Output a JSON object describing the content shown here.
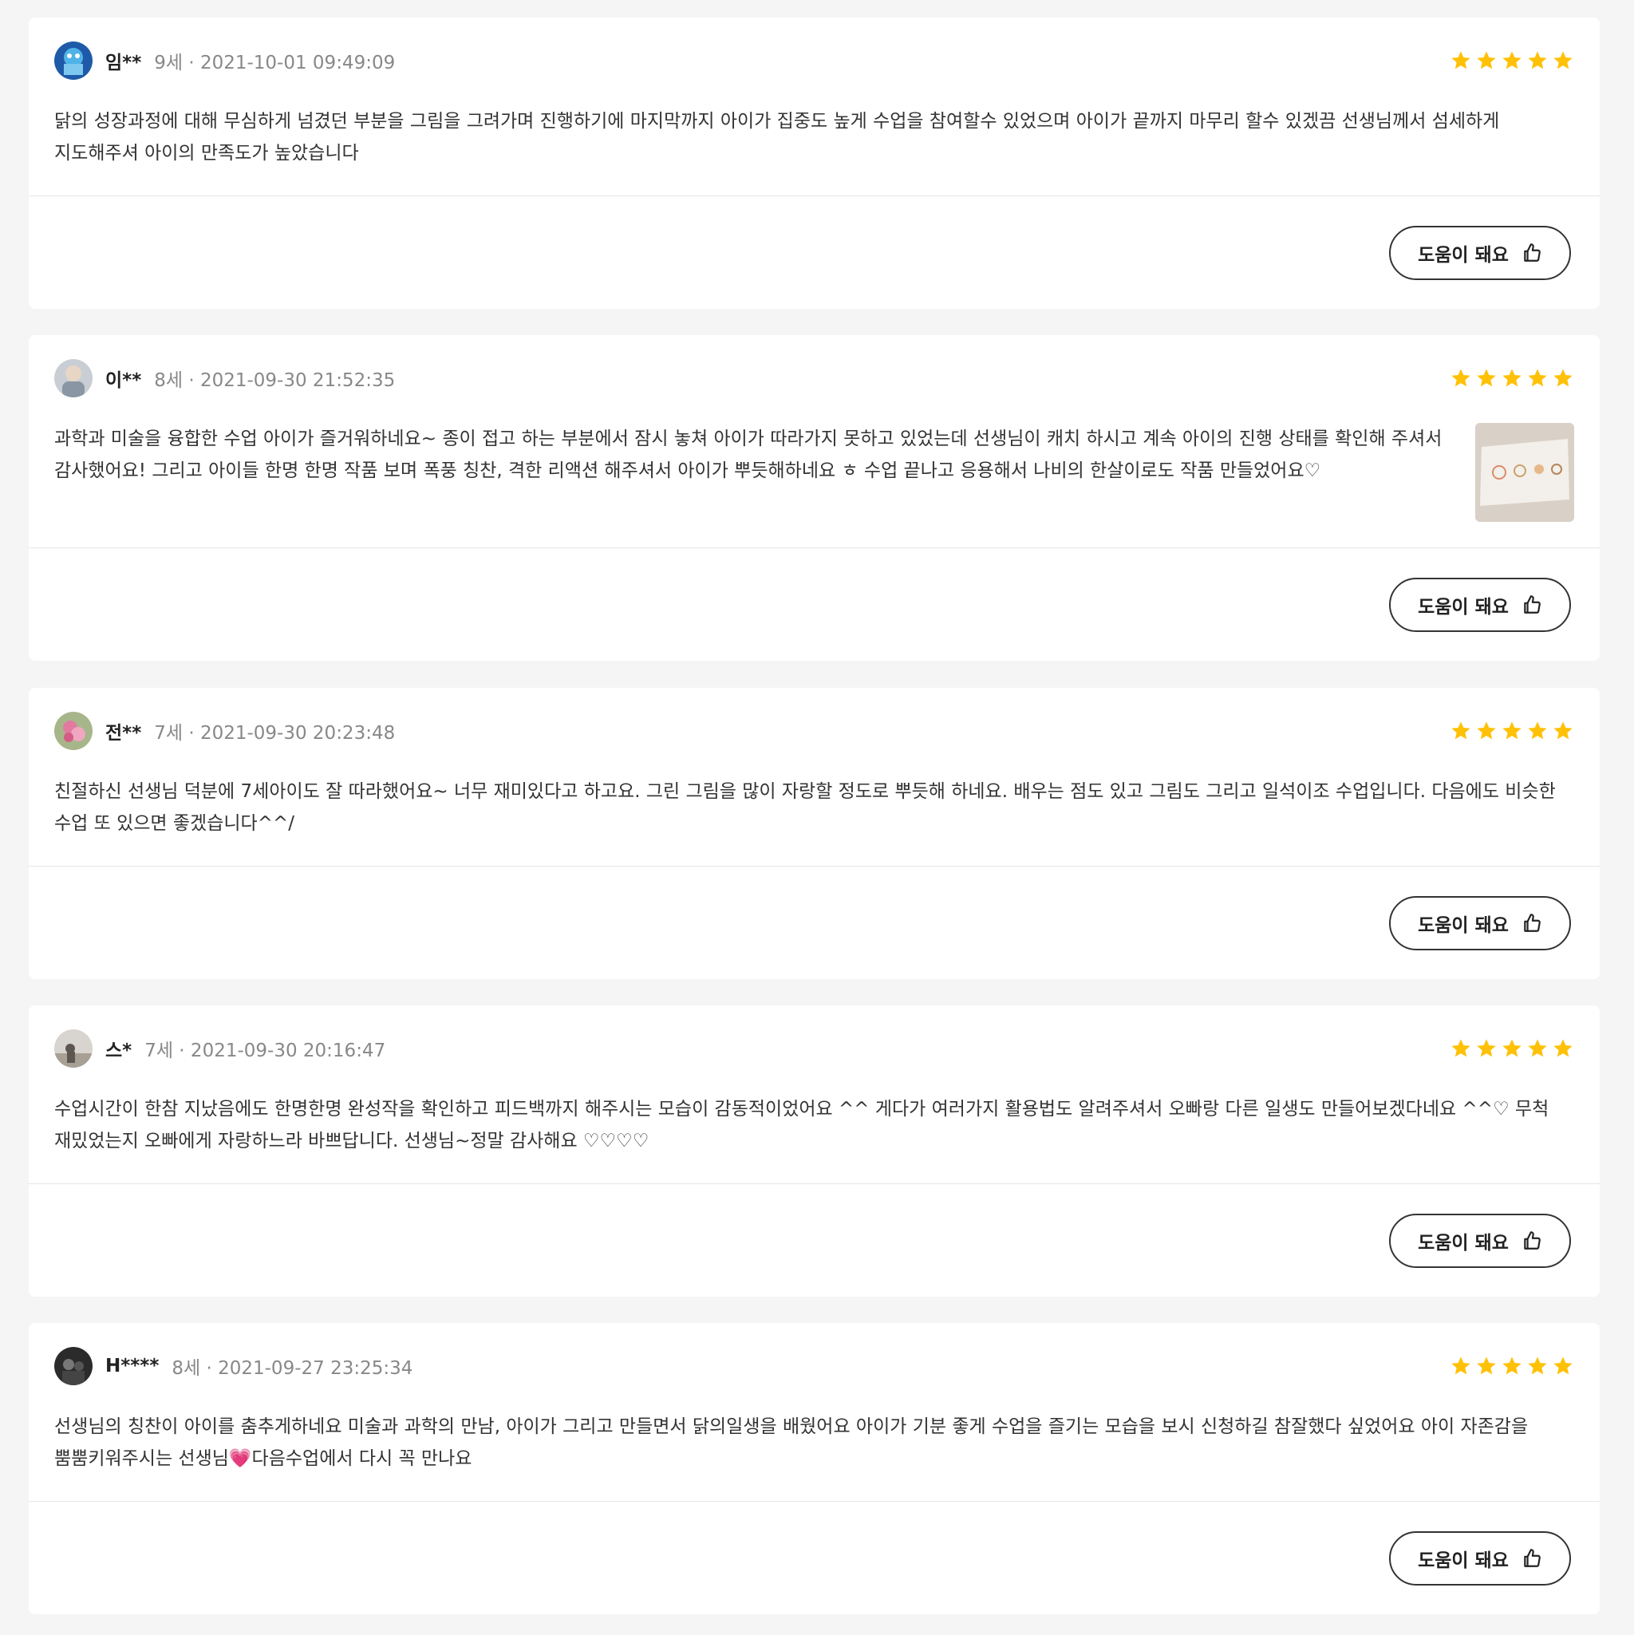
{
  "colors": {
    "star": "#FFC107",
    "background": "#F5F5F5",
    "card": "#FFFFFF",
    "meta_text": "#888888"
  },
  "reviews": [
    {
      "username": "임**",
      "meta": "9세 · 2021-10-01 09:49:09",
      "rating": 5,
      "text": "닭의 성장과정에 대해 무심하게 넘겼던 부분을 그림을 그려가며 진행하기에 마지막까지 아이가 집중도 높게 수업을 참여할수 있었으며 아이가 끝까지 마무리 할수 있겠끔 선생님께서 섬세하게 지도해주셔 아이의 만족도가 높았습니다",
      "helpful_label": "도움이 돼요"
    },
    {
      "username": "이**",
      "meta": "8세 · 2021-09-30 21:52:35",
      "rating": 5,
      "text": "과학과 미술을 융합한 수업 아이가 즐거워하네요~ 종이 접고 하는 부분에서 잠시 놓쳐 아이가 따라가지 못하고 있었는데 선생님이 캐치 하시고 계속 아이의 진행 상태를 확인해 주셔서 감사했어요! 그리고 아이들 한명 한명 작품 보며 폭풍 칭찬, 격한 리액션 해주셔서 아이가 뿌듯해하네요 ㅎ 수업 끝나고 응용해서 나비의 한살이로도 작품 만들었어요♡",
      "helpful_label": "도움이 돼요"
    },
    {
      "username": "전**",
      "meta": "7세 · 2021-09-30 20:23:48",
      "rating": 5,
      "text": "친절하신 선생님 덕분에 7세아이도 잘 따라했어요~ 너무 재미있다고 하고요. 그린 그림을 많이 자랑할 정도로 뿌듯해 하네요. 배우는 점도 있고 그림도 그리고 일석이조 수업입니다. 다음에도 비슷한 수업 또 있으면 좋겠습니다^^/",
      "helpful_label": "도움이 돼요"
    },
    {
      "username": "스*",
      "meta": "7세 · 2021-09-30 20:16:47",
      "rating": 5,
      "text": "수업시간이 한참 지났음에도 한명한명 완성작을 확인하고 피드백까지 해주시는 모습이 감동적이었어요 ^^ 게다가 여러가지 활용법도 알려주셔서 오빠랑 다른 일생도 만들어보겠다네요 ^^♡ 무척 재밌었는지 오빠에게 자랑하느라 바쁘답니다. 선생님~정말 감사해요 ♡♡♡♡",
      "helpful_label": "도움이 돼요"
    },
    {
      "username": "H****",
      "meta": "8세 · 2021-09-27 23:25:34",
      "rating": 5,
      "text": "선생님의 칭찬이 아이를 춤추게하네요 미술과 과학의 만남, 아이가 그리고 만들면서 닭의일생을 배웠어요 아이가 기분 좋게 수업을 즐기는 모습을 보시 신청하길 참잘했다 싶었어요 아이 자존감을 뿜뿜키워주시는 선생님💗다음수업에서 다시 꼭 만나요",
      "helpful_label": "도움이 돼요"
    }
  ]
}
